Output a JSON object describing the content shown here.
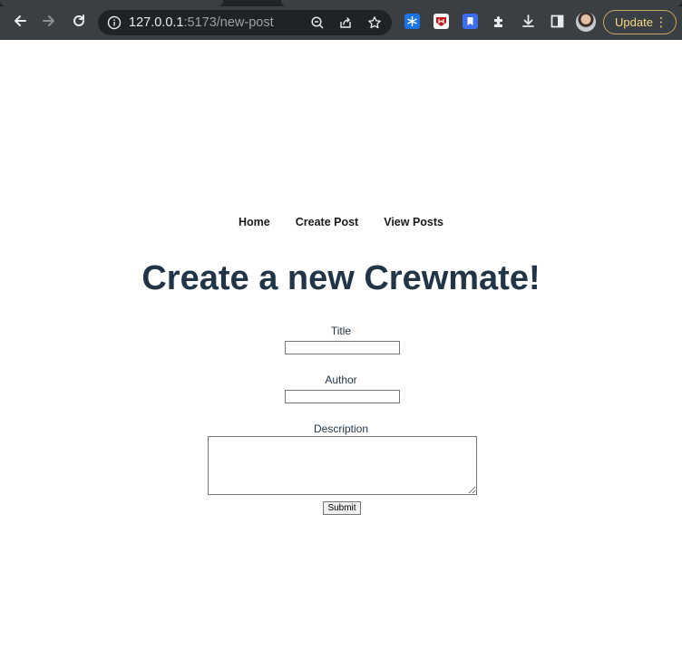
{
  "browser": {
    "url_host": "127.0.0.1",
    "url_rest": ":5173/new-post",
    "update_label": "Update",
    "icons": {
      "back": "arrow-left-icon",
      "forward": "arrow-right-icon",
      "reload": "reload-icon",
      "site_info": "info-icon",
      "zoom": "zoom-out-icon",
      "share": "share-icon",
      "bookmark": "star-icon",
      "extensions": "puzzle-icon",
      "download": "download-icon",
      "sidepanel": "side-panel-icon",
      "menu": "kebab-menu-icon"
    },
    "colors": {
      "toolbar": "#3a3f44",
      "omnibox": "#202326",
      "update_accent": "#f6d887"
    }
  },
  "nav": {
    "items": [
      {
        "label": "Home"
      },
      {
        "label": "Create Post"
      },
      {
        "label": "View Posts"
      }
    ]
  },
  "page": {
    "heading": "Create a new Crewmate!",
    "form": {
      "title_label": "Title",
      "title_value": "",
      "author_label": "Author",
      "author_value": "",
      "description_label": "Description",
      "description_value": "",
      "submit_label": "Submit"
    },
    "colors": {
      "heading": "#213547"
    }
  }
}
